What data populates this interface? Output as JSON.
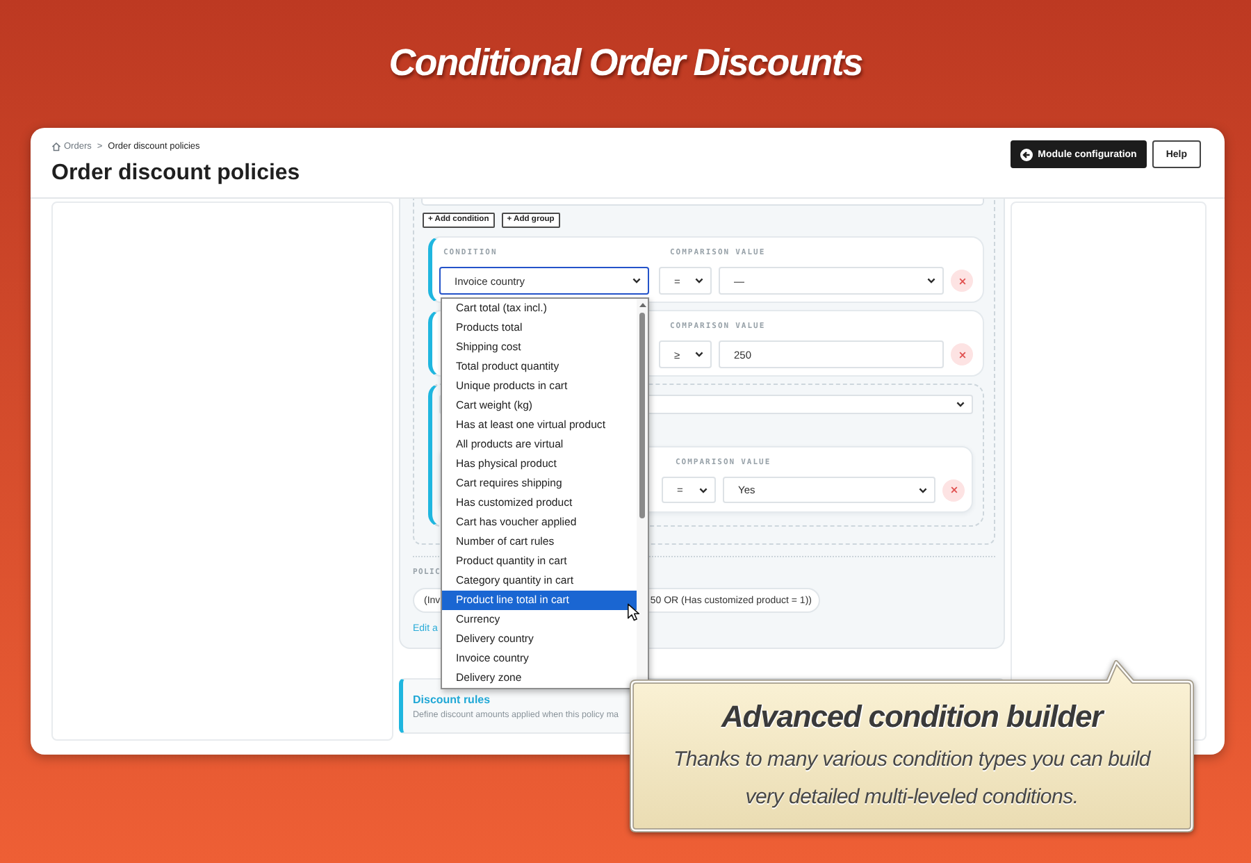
{
  "banner": {
    "title": "Conditional Order Discounts"
  },
  "header": {
    "breadcrumb": [
      {
        "label": "Orders",
        "kind": "link"
      },
      {
        "label": "Order discount policies",
        "kind": "current"
      }
    ],
    "separator": ">",
    "title": "Order discount policies",
    "buttons": [
      {
        "label": "Module configuration",
        "kind": "primary"
      },
      {
        "label": "Help",
        "kind": "secondary"
      }
    ]
  },
  "builder": {
    "actions": [
      "+ Add condition",
      "+ Add group"
    ],
    "rows": [
      {
        "kind": "condition",
        "labels": {
          "condition": "CONDITION",
          "comparison": "COMPARISON",
          "value": "VALUE"
        },
        "condition": {
          "value": "Invoice country",
          "focused": true
        },
        "comparison": "=",
        "value": {
          "kind": "select",
          "text": "—"
        }
      },
      {
        "kind": "condition",
        "labels": {
          "comparison": "COMPARISON",
          "value": "VALUE"
        },
        "comparison": "≥",
        "value": {
          "kind": "input",
          "text": "250"
        }
      },
      {
        "kind": "group",
        "children": [
          {
            "kind": "condition",
            "labels": {
              "comparison": "COMPARISON",
              "value": "VALUE"
            },
            "comparison": "=",
            "value": {
              "kind": "select",
              "text": "Yes"
            }
          }
        ]
      }
    ]
  },
  "dropdown": {
    "options": [
      {
        "label": "Cart total (tax incl.)",
        "selected": false
      },
      {
        "label": "Products total",
        "selected": false
      },
      {
        "label": "Shipping cost",
        "selected": false
      },
      {
        "label": "Total product quantity",
        "selected": false
      },
      {
        "label": "Unique products in cart",
        "selected": false
      },
      {
        "label": "Cart weight (kg)",
        "selected": false
      },
      {
        "label": "Has at least one virtual product",
        "selected": false
      },
      {
        "label": "All products are virtual",
        "selected": false
      },
      {
        "label": "Has physical product",
        "selected": false
      },
      {
        "label": "Cart requires shipping",
        "selected": false
      },
      {
        "label": "Has customized product",
        "selected": false
      },
      {
        "label": "Cart has voucher applied",
        "selected": false
      },
      {
        "label": "Number of cart rules",
        "selected": false
      },
      {
        "label": "Product quantity in cart",
        "selected": false
      },
      {
        "label": "Category quantity in cart",
        "selected": false
      },
      {
        "label": "Product line total in cart",
        "selected": true
      },
      {
        "label": "Currency",
        "selected": false
      },
      {
        "label": "Delivery country",
        "selected": false
      },
      {
        "label": "Invoice country",
        "selected": false
      },
      {
        "label": "Delivery zone",
        "selected": false
      }
    ]
  },
  "summary": {
    "label": "POLIC",
    "parts": [
      "(Inv",
      "50 OR (Has customized product = 1))"
    ],
    "link": "Edit a"
  },
  "discount_rules": {
    "title": "Discount rules",
    "description": "Define discount amounts applied when this policy ma"
  },
  "callout": {
    "title": "Advanced condition builder",
    "lines": [
      "Thanks to many various condition types you can build",
      "very detailed multi-leveled conditions."
    ]
  }
}
